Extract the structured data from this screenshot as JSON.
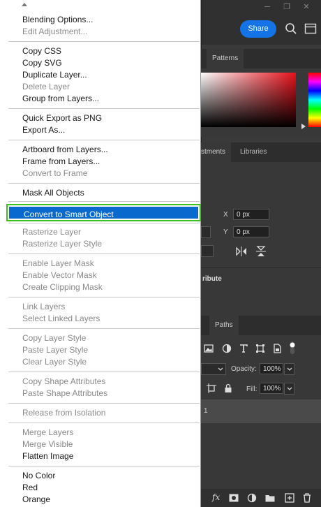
{
  "header": {
    "share_label": "Share"
  },
  "panels": {
    "color_tabs": [
      "Patterns"
    ],
    "properties_tabs": [
      "stments",
      "Libraries"
    ],
    "transform": {
      "x_label": "X",
      "x_value": "0 px",
      "y_label": "Y",
      "y_value": "0 px"
    },
    "attribute_text": "ribute",
    "layers_tabs": [
      "Paths"
    ],
    "opacity_label": "Opacity:",
    "opacity_value": "100%",
    "fill_label": "Fill:",
    "fill_value": "100%",
    "layer_row_text": "1",
    "fx_label": "fx",
    "accent_color": "#1473e6"
  },
  "menu": {
    "items": [
      {
        "label": "Blending Options...",
        "enabled": true
      },
      {
        "label": "Edit Adjustment...",
        "enabled": false
      },
      {
        "label": "Copy CSS",
        "enabled": true
      },
      {
        "label": "Copy SVG",
        "enabled": true
      },
      {
        "label": "Duplicate Layer...",
        "enabled": true
      },
      {
        "label": "Delete Layer",
        "enabled": false
      },
      {
        "label": "Group from Layers...",
        "enabled": true
      },
      {
        "label": "Quick Export as PNG",
        "enabled": true
      },
      {
        "label": "Export As...",
        "enabled": true
      },
      {
        "label": "Artboard from Layers...",
        "enabled": true
      },
      {
        "label": "Frame from Layers...",
        "enabled": true
      },
      {
        "label": "Convert to Frame",
        "enabled": false
      },
      {
        "label": "Mask All Objects",
        "enabled": true
      },
      {
        "label": "Convert to Smart Object",
        "enabled": true,
        "highlighted": true
      },
      {
        "label": "Rasterize Layer",
        "enabled": false
      },
      {
        "label": "Rasterize Layer Style",
        "enabled": false
      },
      {
        "label": "Enable Layer Mask",
        "enabled": false
      },
      {
        "label": "Enable Vector Mask",
        "enabled": false
      },
      {
        "label": "Create Clipping Mask",
        "enabled": false
      },
      {
        "label": "Link Layers",
        "enabled": false
      },
      {
        "label": "Select Linked Layers",
        "enabled": false
      },
      {
        "label": "Copy Layer Style",
        "enabled": false
      },
      {
        "label": "Paste Layer Style",
        "enabled": false
      },
      {
        "label": "Clear Layer Style",
        "enabled": false
      },
      {
        "label": "Copy Shape Attributes",
        "enabled": false
      },
      {
        "label": "Paste Shape Attributes",
        "enabled": false
      },
      {
        "label": "Release from Isolation",
        "enabled": false
      },
      {
        "label": "Merge Layers",
        "enabled": false
      },
      {
        "label": "Merge Visible",
        "enabled": false
      },
      {
        "label": "Flatten Image",
        "enabled": true
      },
      {
        "label": "No Color",
        "enabled": true
      },
      {
        "label": "Red",
        "enabled": true
      },
      {
        "label": "Orange",
        "enabled": true
      }
    ],
    "highlight_color": "#0a69cc",
    "highlight_outline_color": "#3ec01f"
  }
}
